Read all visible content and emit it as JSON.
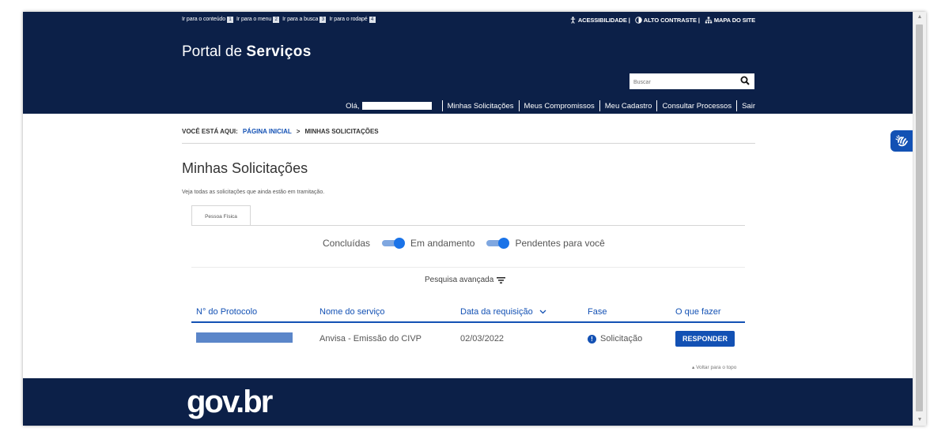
{
  "header": {
    "skip_links": [
      {
        "label": "Ir para o conteúdo",
        "num": "1"
      },
      {
        "label": "Ir para o menu",
        "num": "2"
      },
      {
        "label": "Ir para a busca",
        "num": "3"
      },
      {
        "label": "Ir para o rodapé",
        "num": "4"
      }
    ],
    "accessibility": "ACESSIBILIDADE",
    "high_contrast": "ALTO CONTRASTE",
    "sitemap": "MAPA DO SITE",
    "title_light": "Portal de ",
    "title_bold": "Serviços",
    "search_placeholder": "Buscar",
    "greeting": "Olá,",
    "nav": [
      "Minhas Solicitações",
      "Meus Compromissos",
      "Meu Cadastro",
      "Consultar Processos",
      "Sair"
    ]
  },
  "breadcrumb": {
    "prefix": "VOCÊ ESTÁ AQUI:",
    "home": "PÁGINA INICIAL",
    "separator": ">",
    "current": "MINHAS SOLICITAÇÕES"
  },
  "main": {
    "title": "Minhas Solicitações",
    "subtitle": "Veja todas as solicitações que ainda estão em tramitação.",
    "tab": "Pessoa Física",
    "toggles": [
      {
        "label": "Concluídas",
        "on": true
      },
      {
        "label": "Em andamento",
        "on": true
      },
      {
        "label": "Pendentes para você",
        "on": false
      }
    ],
    "advanced_search": "Pesquisa avançada",
    "table": {
      "headers": [
        "N° do Protocolo",
        "Nome do serviço",
        "Data da requisição",
        "Fase",
        "O que fazer"
      ],
      "rows": [
        {
          "protocol": "",
          "service": "Anvisa - Emissão do CIVP",
          "date": "02/03/2022",
          "phase": "Solicitação",
          "action": "RESPONDER"
        }
      ]
    },
    "back_to_top": "Voltar para o topo"
  },
  "footer": {
    "logo": "gov.br"
  },
  "colors": {
    "header_bg": "#0c2048",
    "accent": "#1351b4",
    "toggle": "#1a73e8"
  },
  "icons": [
    "accessibility-icon",
    "contrast-icon",
    "sitemap-icon",
    "search-icon",
    "filter-icon",
    "chevron-down-icon",
    "info-icon",
    "vlibras-icon"
  ]
}
